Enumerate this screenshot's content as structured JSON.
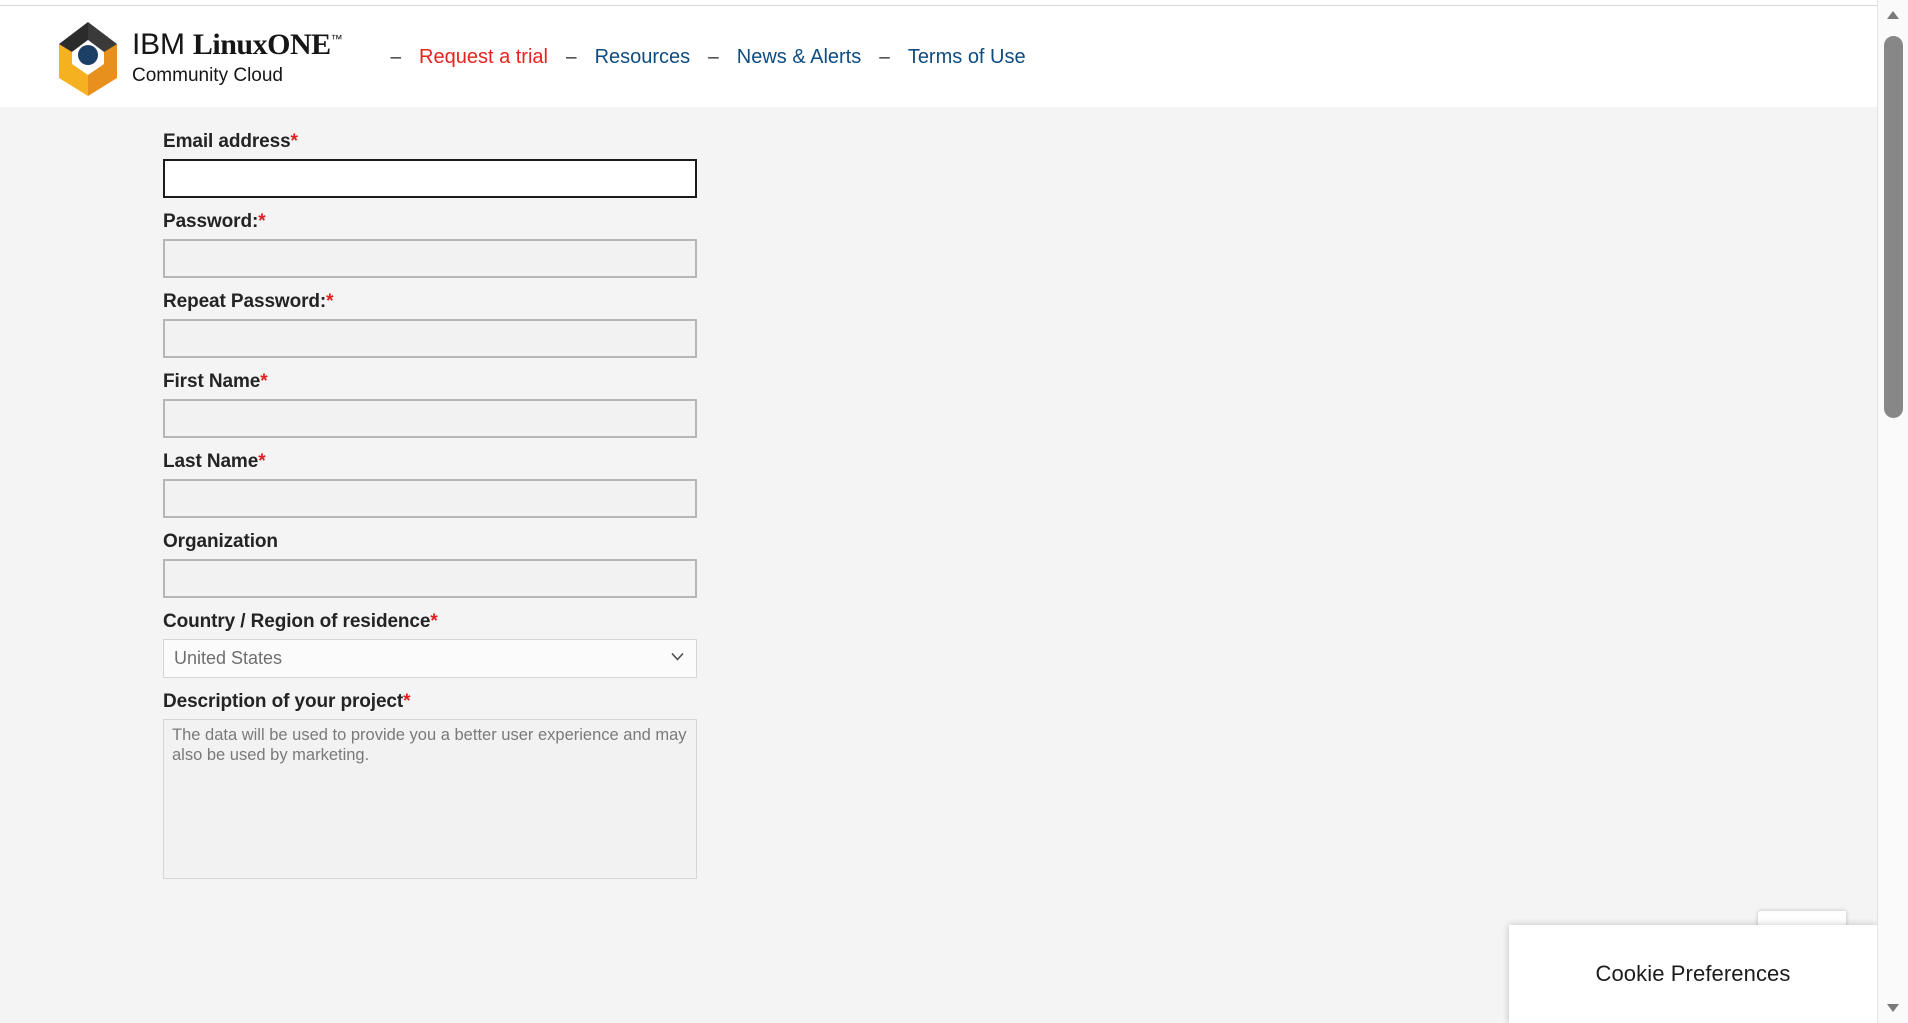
{
  "header": {
    "brand": {
      "logo_icon": "linuxone-cube-logo-icon",
      "ibm": "IBM",
      "linuxone": "LinuxONE",
      "tm": "™",
      "community_cloud": "Community Cloud"
    },
    "nav_separator": "–",
    "nav": [
      {
        "label": "Request a trial",
        "style": "accent",
        "color": "#e8231f"
      },
      {
        "label": "Resources",
        "style": "normal",
        "color": "#0f4c81"
      },
      {
        "label": "News & Alerts",
        "style": "normal",
        "color": "#0f4c81"
      },
      {
        "label": "Terms of Use",
        "style": "normal",
        "color": "#0f4c81"
      }
    ]
  },
  "form": {
    "required_marker": "*",
    "fields": [
      {
        "label": "Email address",
        "required": true,
        "type": "text",
        "value": "",
        "placeholder": "",
        "focused": true
      },
      {
        "label": "Password:",
        "required": true,
        "type": "password",
        "value": "",
        "placeholder": "",
        "focused": false
      },
      {
        "label": "Repeat Password:",
        "required": true,
        "type": "password",
        "value": "",
        "placeholder": "",
        "focused": false
      },
      {
        "label": "First Name",
        "required": true,
        "type": "text",
        "value": "",
        "placeholder": "",
        "focused": false
      },
      {
        "label": "Last Name",
        "required": true,
        "type": "text",
        "value": "",
        "placeholder": "",
        "focused": false
      },
      {
        "label": "Organization",
        "required": false,
        "type": "text",
        "value": "",
        "placeholder": "",
        "focused": false
      },
      {
        "label": "Country / Region of residence",
        "required": true,
        "type": "select",
        "value": "United States",
        "options": [
          "United States"
        ],
        "focused": false
      },
      {
        "label": "Description of your project",
        "required": true,
        "type": "textarea",
        "value": "",
        "placeholder": "The data will be used to provide you a better user experience and may also be used by marketing.",
        "focused": false
      }
    ]
  },
  "recaptcha": {
    "icon": "recaptcha-logo-icon"
  },
  "cookie_preferences": {
    "label": "Cookie Preferences"
  },
  "scrollbar": {
    "up_arrow": "▲",
    "down_arrow": "▼"
  },
  "colors": {
    "page_background": "#f4f4f4",
    "header_background": "#ffffff",
    "accent_red": "#e8231f",
    "link_blue": "#0f4c81",
    "required_red": "#e02020",
    "logo_dark": "#2b2b2b",
    "logo_yellow": "#f5b11f",
    "logo_orange": "#e8901e",
    "logo_dot_blue": "#1c3f66"
  }
}
